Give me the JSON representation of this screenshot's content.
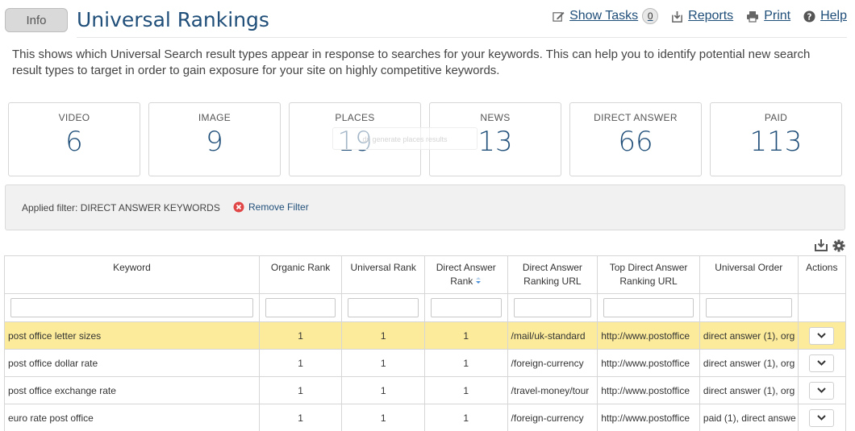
{
  "header": {
    "info_label": "Info",
    "title": "Universal Rankings",
    "show_tasks_label": "Show Tasks",
    "task_count": "0",
    "reports_label": "Reports",
    "print_label": "Print",
    "help_label": "Help"
  },
  "description": "This shows which Universal Search result types appear in response to searches for your keywords. This can help you to identify potential new search result types to target in order to gain exposure for your site on highly competitive keywords.",
  "stats": [
    {
      "label": "VIDEO",
      "value": "6"
    },
    {
      "label": "IMAGE",
      "value": "9"
    },
    {
      "label": "PLACES",
      "value": "19"
    },
    {
      "label": "NEWS",
      "value": "13"
    },
    {
      "label": "DIRECT ANSWER",
      "value": "66"
    },
    {
      "label": "PAID",
      "value": "113"
    }
  ],
  "ghost_tooltip": "ds generate places results",
  "filter": {
    "applied_text": "Applied filter: DIRECT ANSWER KEYWORDS",
    "remove_label": "Remove Filter"
  },
  "table": {
    "headers": {
      "keyword": "Keyword",
      "organic_rank": "Organic Rank",
      "universal_rank": "Universal Rank",
      "direct_answer_rank": "Direct Answer Rank",
      "direct_answer_url": "Direct Answer Ranking URL",
      "top_direct_answer_url": "Top Direct Answer Ranking URL",
      "universal_order": "Universal Order",
      "actions": "Actions"
    },
    "rows": [
      {
        "keyword": "post office letter sizes",
        "organic": "1",
        "universal": "1",
        "da_rank": "1",
        "da_url": "/mail/uk-standard",
        "top_url": "http://www.postoffice",
        "order": "direct answer (1), org"
      },
      {
        "keyword": "post office dollar rate",
        "organic": "1",
        "universal": "1",
        "da_rank": "1",
        "da_url": "/foreign-currency",
        "top_url": "http://www.postoffice",
        "order": "direct answer (1), org"
      },
      {
        "keyword": "post office exchange rate",
        "organic": "1",
        "universal": "1",
        "da_rank": "1",
        "da_url": "/travel-money/tour",
        "top_url": "http://www.postoffice",
        "order": "direct answer (1), org"
      },
      {
        "keyword": "euro rate post office",
        "organic": "1",
        "universal": "1",
        "da_rank": "1",
        "da_url": "/foreign-currency",
        "top_url": "http://www.postoffice",
        "order": "paid (1), direct answe"
      }
    ]
  },
  "colors": {
    "title": "#1f4e79",
    "highlight_row": "#fbeb9a",
    "remove_icon": "#e04646"
  }
}
